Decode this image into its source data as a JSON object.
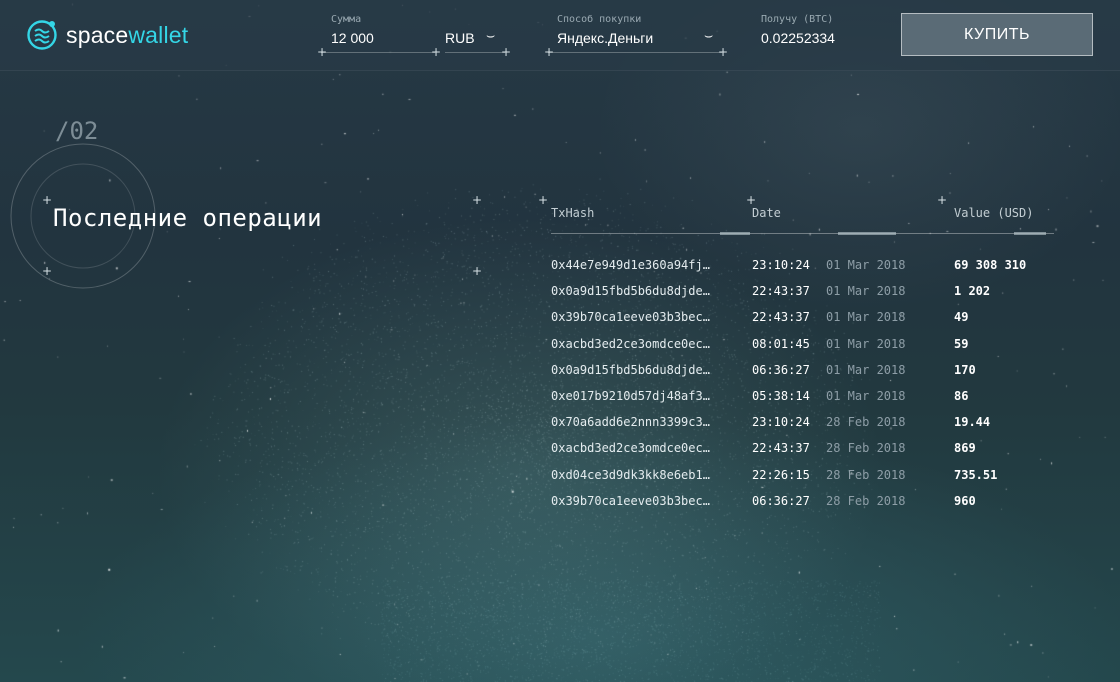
{
  "app": {
    "logo_part1": "space",
    "logo_part2": "wallet",
    "brand_color": "#34d6e6",
    "logo_icon": "spacewallet-logo-icon"
  },
  "purchase": {
    "amount_label": "Сумма",
    "amount_value": "12 000",
    "currency_value": "RUB",
    "method_label": "Способ покупки",
    "method_value": "Яндекс.Деньги",
    "receive_label": "Получу (BTC)",
    "receive_value": "0.02252334",
    "buy_label": "КУПИТЬ"
  },
  "section": {
    "number": "/02",
    "title": "Последние операции"
  },
  "table": {
    "columns": {
      "hash": "TxHash",
      "date": "Date",
      "value": "Value (USD)"
    },
    "rows": [
      {
        "hash": "0x44e7e949d1e360a94fj…",
        "time": "23:10:24",
        "date": "01 Mar 2018",
        "value": "69 308 310"
      },
      {
        "hash": "0x0a9d15fbd5b6du8djde…",
        "time": "22:43:37",
        "date": "01 Mar 2018",
        "value": "1 202"
      },
      {
        "hash": "0x39b70ca1eeve03b3bec…",
        "time": "22:43:37",
        "date": "01 Mar 2018",
        "value": "49"
      },
      {
        "hash": "0xacbd3ed2ce3omdce0ec…",
        "time": "08:01:45",
        "date": "01 Mar 2018",
        "value": "59"
      },
      {
        "hash": "0x0a9d15fbd5b6du8djde…",
        "time": "06:36:27",
        "date": "01 Mar 2018",
        "value": "170"
      },
      {
        "hash": "0xe017b9210d57dj48af3…",
        "time": "05:38:14",
        "date": "01 Mar 2018",
        "value": "86"
      },
      {
        "hash": "0x70a6add6e2nnn3399c3…",
        "time": "23:10:24",
        "date": "28 Feb 2018",
        "value": "19.44"
      },
      {
        "hash": "0xacbd3ed2ce3omdce0ec…",
        "time": "22:43:37",
        "date": "28 Feb 2018",
        "value": "869"
      },
      {
        "hash": "0xd04ce3d9dk3kk8e6eb1…",
        "time": "22:26:15",
        "date": "28 Feb 2018",
        "value": "735.51"
      },
      {
        "hash": "0x39b70ca1eeve03b3bec…",
        "time": "06:36:27",
        "date": "28 Feb 2018",
        "value": "960"
      }
    ]
  }
}
